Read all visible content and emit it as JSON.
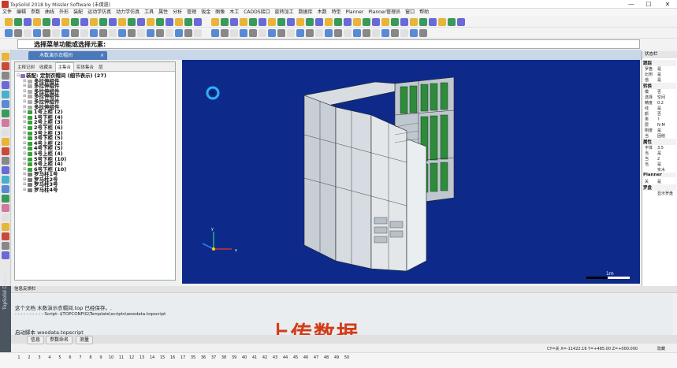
{
  "window": {
    "title": "TopSolid 2018 by Missler Software (未償還)",
    "controls": [
      "—",
      "☐",
      "✕"
    ]
  },
  "menubar": [
    "文件",
    "编辑",
    "参数",
    "曲线",
    "外形",
    "装配",
    "运动学仿真",
    "动力学仿真",
    "工具",
    "属性",
    "分析",
    "管理",
    "钣金",
    "图像",
    "木工",
    "CADDS接口",
    "旋转加工",
    "数据库",
    "木数",
    "特型",
    "Planner",
    "Planner管理员",
    "窗口",
    "帮助"
  ],
  "command_prompt": "选择菜单功能或选择元素:",
  "document_tab": {
    "label": "木数演示衣帽间"
  },
  "tree_panel": {
    "tabs": [
      "主释记树",
      "收藏夹",
      "主集合",
      "实体集合",
      "层"
    ],
    "active_tab": 2,
    "rows": [
      {
        "label": "装配: 定制衣帽间 (细节表示) (27)",
        "icon": "assembly"
      },
      {
        "label": "多拉伸组件",
        "icon": "component"
      },
      {
        "label": "多拉伸组件",
        "icon": "component"
      },
      {
        "label": "多拉伸组件",
        "icon": "component"
      },
      {
        "label": "多拉伸组件",
        "icon": "component"
      },
      {
        "label": "多拉伸组件",
        "icon": "component"
      },
      {
        "label": "多拉伸组件",
        "icon": "component"
      },
      {
        "label": "1号上柜 (2)",
        "icon": "cabinet"
      },
      {
        "label": "1号下柜 (4)",
        "icon": "cabinet"
      },
      {
        "label": "2号上柜 (3)",
        "icon": "cabinet"
      },
      {
        "label": "2号下柜 (6)",
        "icon": "cabinet"
      },
      {
        "label": "3号上柜 (3)",
        "icon": "cabinet"
      },
      {
        "label": "3号下柜 (5)",
        "icon": "cabinet"
      },
      {
        "label": "4号上柜 (2)",
        "icon": "cabinet"
      },
      {
        "label": "4号下柜 (5)",
        "icon": "cabinet"
      },
      {
        "label": "5号上柜 (4)",
        "icon": "cabinet"
      },
      {
        "label": "5号下柜 (10)",
        "icon": "cabinet"
      },
      {
        "label": "6号上柜 (4)",
        "icon": "cabinet"
      },
      {
        "label": "6号下柜 (10)",
        "icon": "cabinet"
      },
      {
        "label": "罗马柱1号",
        "icon": "pillar"
      },
      {
        "label": "罗马柱2号",
        "icon": "pillar"
      },
      {
        "label": "罗马柱3号",
        "icon": "pillar"
      },
      {
        "label": "罗马柱4号",
        "icon": "pillar"
      }
    ]
  },
  "viewport": {
    "scale_label": "1m",
    "background": "#0d2a8a",
    "glass": "#2e8b3a"
  },
  "right_panel": {
    "title": "状态栏",
    "rows": [
      {
        "section": "跟踪"
      },
      {
        "k": "罗盘",
        "v": "是"
      },
      {
        "k": "比例",
        "v": "是"
      },
      {
        "k": "值",
        "v": "是"
      },
      {
        "section": "转换"
      },
      {
        "k": "模",
        "v": "否"
      },
      {
        "k": "选择",
        "v": "空间"
      },
      {
        "k": "精度",
        "v": "0.2"
      },
      {
        "k": "线",
        "v": "是"
      },
      {
        "k": "颜",
        "v": "否"
      },
      {
        "k": "类",
        "v": "?"
      },
      {
        "k": "层",
        "v": "N-M"
      },
      {
        "k": "刚度",
        "v": "是"
      },
      {
        "k": "当",
        "v": "固结"
      },
      {
        "section": "属性"
      },
      {
        "k": "字体",
        "v": "3.5"
      },
      {
        "k": "当",
        "v": "是"
      },
      {
        "k": "当",
        "v": "2"
      },
      {
        "k": "当",
        "v": "是"
      },
      {
        "k": "",
        "v": "实木"
      },
      {
        "section": "Planner"
      },
      {
        "k": "关",
        "v": "是"
      },
      {
        "section": "罗盘"
      },
      {
        "k": "",
        "v": "显示罗盘"
      }
    ]
  },
  "messages": {
    "title": "信息反馈栏",
    "lines": [
      "这个文档 木数演示衣帽间.top 已经保存。.",
      "- - - - - - - - - - Script: $TOPCONFIG\\Template\\scripts\\woodata.topscript",
      "启动脚本 woodata.topscript"
    ]
  },
  "overlay_caption": "上传数据",
  "bottom_tabs": [
    "信息",
    "参数命名",
    "测量"
  ],
  "status": {
    "coords": "CY=关  X=-11422.16 Y=+485.00 Z=+000.000",
    "mode": "隐藏"
  },
  "numbers": [
    "1",
    "2",
    "3",
    "4",
    "5",
    "6",
    "7",
    "8",
    "9",
    "10",
    "11",
    "12",
    "13",
    "14",
    "15",
    "16",
    "17",
    "35",
    "36",
    "37",
    "38",
    "39",
    "40",
    "41",
    "42",
    "43",
    "44",
    "45",
    "46",
    "47",
    "48",
    "49",
    "50"
  ],
  "side_brand": "TopSolid Design"
}
